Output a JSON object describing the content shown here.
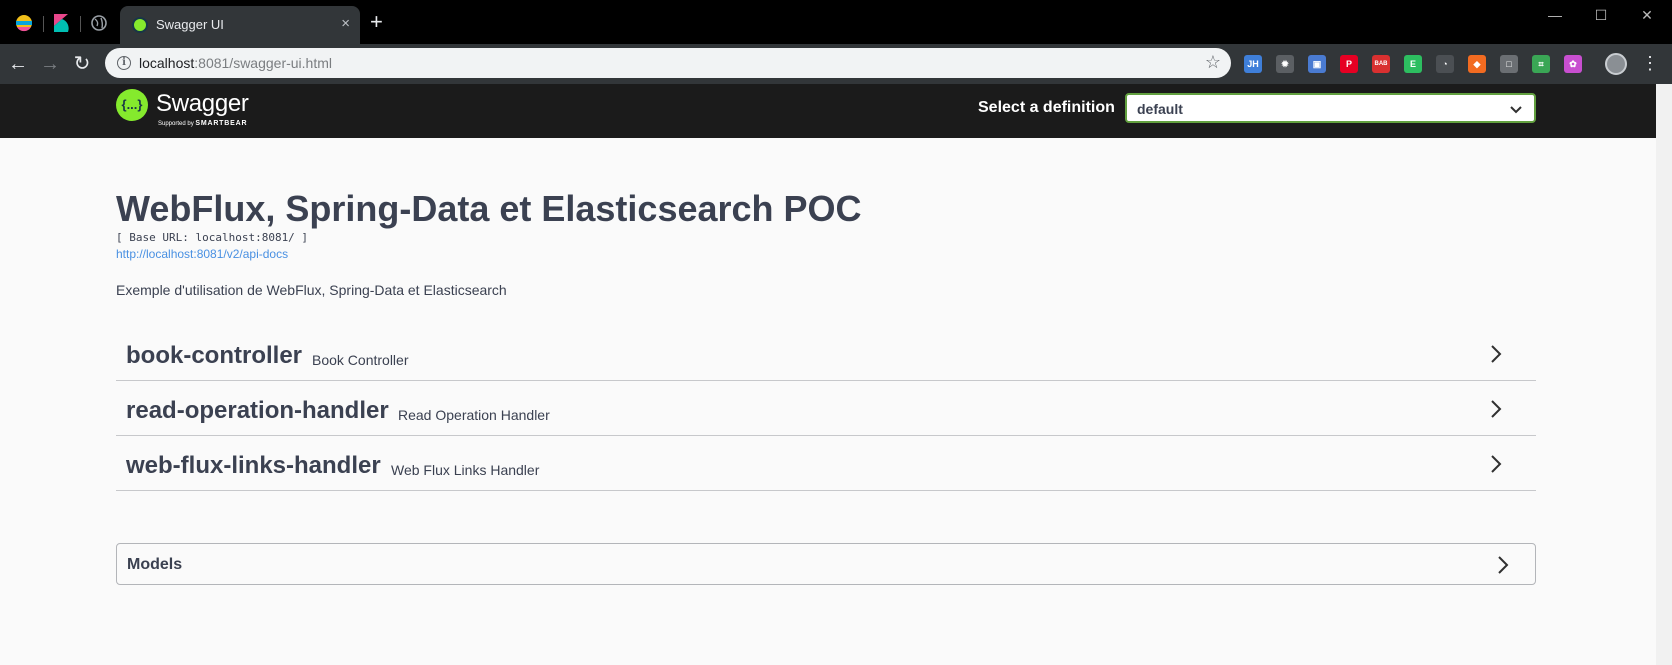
{
  "browser": {
    "tab_title": "Swagger UI",
    "tab_close": "×",
    "new_tab": "+",
    "url_host": "localhost",
    "url_path": ":8081/swagger-ui.html",
    "extensions": [
      {
        "name": "jhipster-extension-icon",
        "text": "JH",
        "color": "#3f7fd9"
      },
      {
        "name": "settings-extension-icon",
        "text": "✹",
        "color": "#5b5f63"
      },
      {
        "name": "screenshot-extension-icon",
        "text": "▣",
        "color": "#4a7bd1"
      },
      {
        "name": "pinterest-extension-icon",
        "text": "P",
        "color": "#e60023"
      },
      {
        "name": "adblock-extension-icon",
        "text": "BAB",
        "color": "#d93030"
      },
      {
        "name": "evernote-extension-icon",
        "text": "E",
        "color": "#2dbe60"
      },
      {
        "name": "ghostery-extension-icon",
        "text": "◔",
        "color": "#4b4f53"
      },
      {
        "name": "octotree-extension-icon",
        "text": "◆",
        "color": "#f26b21"
      },
      {
        "name": "box-extension-icon",
        "text": "□",
        "color": "#6b6f73"
      },
      {
        "name": "selection-extension-icon",
        "text": "⌗",
        "color": "#3aa655"
      },
      {
        "name": "color-picker-extension-icon",
        "text": "✿",
        "color": "#c84fd0"
      }
    ]
  },
  "swagger": {
    "logo_text": "Swagger",
    "logo_sub_prefix": "Supported by",
    "logo_sub_brand": "SMARTBEAR",
    "definition_label": "Select a definition",
    "definition_value": "default"
  },
  "info": {
    "title": "WebFlux, Spring-Data et Elasticsearch POC",
    "base_url": "[ Base URL: localhost:8081/ ]",
    "api_docs_link": "http://localhost:8081/v2/api-docs",
    "description": "Exemple d'utilisation de WebFlux, Spring-Data et Elasticsearch"
  },
  "tags": [
    {
      "name": "book-controller",
      "description": "Book Controller"
    },
    {
      "name": "read-operation-handler",
      "description": "Read Operation Handler"
    },
    {
      "name": "web-flux-links-handler",
      "description": "Web Flux Links Handler"
    }
  ],
  "models": {
    "label": "Models"
  }
}
